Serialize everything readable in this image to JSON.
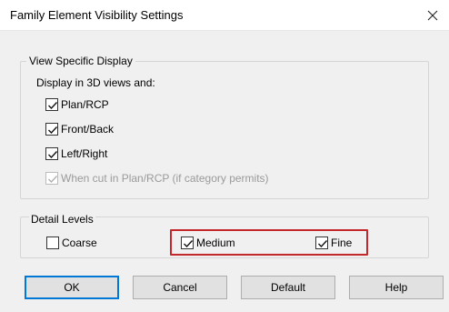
{
  "window": {
    "title": "Family Element Visibility Settings",
    "close_glyph": "✕"
  },
  "view_specific": {
    "group_label": "View Specific Display",
    "sub_label": "Display in 3D views and:",
    "options": [
      {
        "label": "Plan/RCP",
        "checked": true,
        "enabled": true
      },
      {
        "label": "Front/Back",
        "checked": true,
        "enabled": true
      },
      {
        "label": "Left/Right",
        "checked": true,
        "enabled": true
      },
      {
        "label": "When cut in Plan/RCP (if category permits)",
        "checked": true,
        "enabled": false
      }
    ]
  },
  "detail_levels": {
    "group_label": "Detail Levels",
    "options": [
      {
        "label": "Coarse",
        "checked": false
      },
      {
        "label": "Medium",
        "checked": true
      },
      {
        "label": "Fine",
        "checked": true
      }
    ],
    "highlight_color": "#c4282d"
  },
  "buttons": {
    "ok": "OK",
    "cancel": "Cancel",
    "default": "Default",
    "help": "Help"
  },
  "colors": {
    "accent": "#0078d7",
    "dialog_bg": "#f0f0f0"
  }
}
